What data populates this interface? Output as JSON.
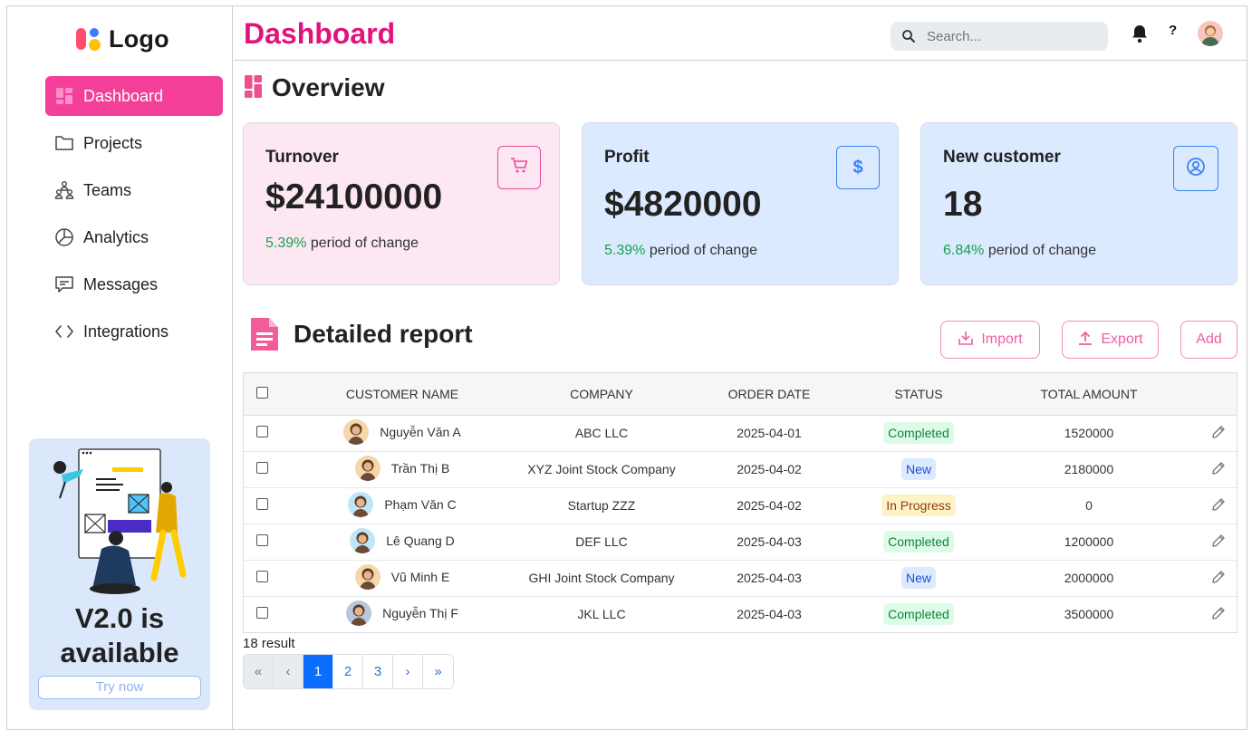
{
  "brand": {
    "logo_text": "Logo"
  },
  "sidebar": {
    "items": [
      {
        "label": "Dashboard",
        "icon": "dashboard-grid-icon",
        "active": true
      },
      {
        "label": "Projects",
        "icon": "folder-icon"
      },
      {
        "label": "Teams",
        "icon": "teams-icon"
      },
      {
        "label": "Analytics",
        "icon": "pie-chart-icon"
      },
      {
        "label": "Messages",
        "icon": "message-icon"
      },
      {
        "label": "Integrations",
        "icon": "code-icon"
      }
    ],
    "promo": {
      "title": "V2.0 is available",
      "button": "Try now"
    }
  },
  "header": {
    "title": "Dashboard",
    "search_placeholder": "Search...",
    "help": "?"
  },
  "overview": {
    "title": "Overview",
    "cards": [
      {
        "title": "Turnover",
        "value": "$24100000",
        "change": "5.39%",
        "change_text": "period of change",
        "icon": "cart-icon",
        "bg": "#fce7f3",
        "accent": "#ec4899"
      },
      {
        "title": "Profit",
        "value": "$4820000",
        "change": "5.39%",
        "change_text": "period of change",
        "icon": "dollar-icon",
        "bg": "#dbeafe",
        "accent": "#3b82f6"
      },
      {
        "title": "New customer",
        "value": "18",
        "change": "6.84%",
        "change_text": "period of change",
        "icon": "user-circle-icon",
        "bg": "#dbeafe",
        "accent": "#3b82f6"
      }
    ]
  },
  "report": {
    "title": "Detailed report",
    "buttons": {
      "import": "Import",
      "export": "Export",
      "add": "Add"
    },
    "columns": [
      "CUSTOMER NAME",
      "COMPANY",
      "ORDER DATE",
      "STATUS",
      "TOTAL AMOUNT"
    ],
    "rows": [
      {
        "name": "Nguyễn Văn A",
        "company": "ABC LLC",
        "date": "2025-04-01",
        "status": "Completed",
        "status_type": "completed",
        "amount": "1520000",
        "avatar": "#f7d6a8"
      },
      {
        "name": "Trần Thị B",
        "company": "XYZ Joint Stock Company",
        "date": "2025-04-02",
        "status": "New",
        "status_type": "new",
        "amount": "2180000",
        "avatar": "#f7d6a8"
      },
      {
        "name": "Phạm Văn C",
        "company": "Startup ZZZ",
        "date": "2025-04-02",
        "status": "In Progress",
        "status_type": "progress",
        "amount": "0",
        "avatar": "#bfe6f5"
      },
      {
        "name": "Lê Quang D",
        "company": "DEF LLC",
        "date": "2025-04-03",
        "status": "Completed",
        "status_type": "completed",
        "amount": "1200000",
        "avatar": "#bfe6f5"
      },
      {
        "name": "Vũ Minh E",
        "company": "GHI Joint Stock Company",
        "date": "2025-04-03",
        "status": "New",
        "status_type": "new",
        "amount": "2000000",
        "avatar": "#f7d6a8"
      },
      {
        "name": "Nguyễn Thị F",
        "company": "JKL LLC",
        "date": "2025-04-03",
        "status": "Completed",
        "status_type": "completed",
        "amount": "3500000",
        "avatar": "#b8c7dd"
      }
    ],
    "result_text": "18 result",
    "pagination": [
      "«",
      "‹",
      "1",
      "2",
      "3",
      "›",
      "»"
    ],
    "current_page": "1"
  }
}
